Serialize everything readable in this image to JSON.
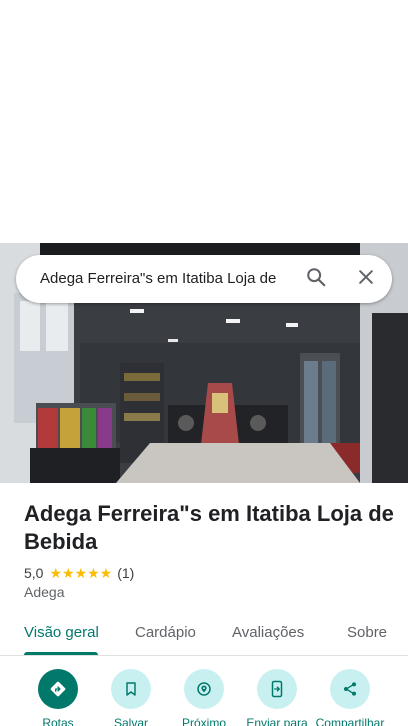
{
  "search": {
    "query": "Adega Ferreira\"s em Itatiba Loja de"
  },
  "place": {
    "name": "Adega Ferreira\"s em Itatiba Loja de Bebida",
    "rating": "5,0",
    "stars": "★★★★★",
    "review_count": "(1)",
    "category": "Adega"
  },
  "tabs": [
    {
      "label": "Visão geral",
      "active": true
    },
    {
      "label": "Cardápio",
      "active": false
    },
    {
      "label": "Avaliações",
      "active": false
    },
    {
      "label": "Sobre",
      "active": false
    }
  ],
  "actions": [
    {
      "label": "Rotas",
      "icon": "directions-icon"
    },
    {
      "label": "Salvar",
      "icon": "bookmark-icon"
    },
    {
      "label": "Próximo",
      "icon": "nearby-icon"
    },
    {
      "label": "Enviar para",
      "icon": "send-to-phone-icon"
    },
    {
      "label": "Compartilhar",
      "icon": "share-icon"
    }
  ],
  "colors": {
    "accent": "#00796b",
    "action_bg": "#c9f0f1",
    "star": "#fbbc04"
  }
}
